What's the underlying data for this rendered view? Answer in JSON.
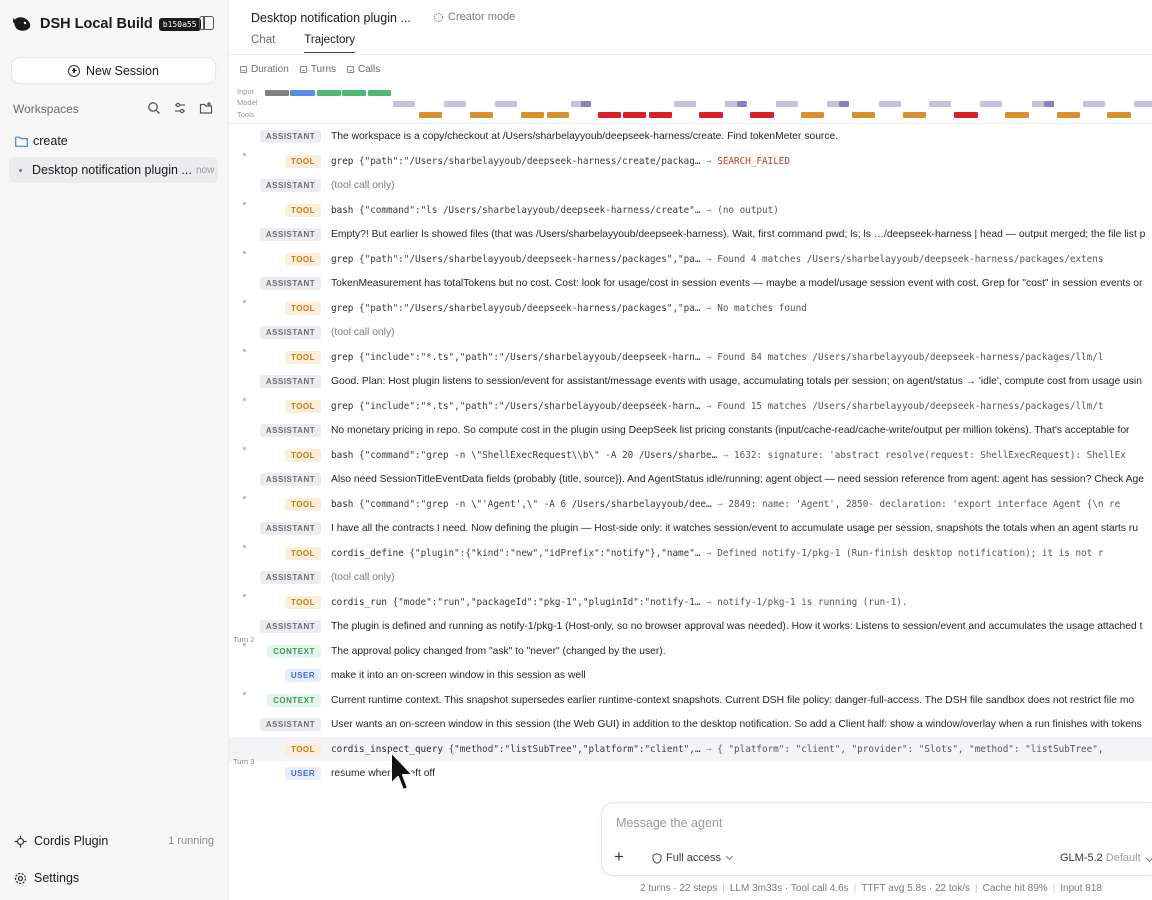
{
  "app": {
    "title": "DSH Local Build",
    "build_badge": "b150a55"
  },
  "sidebar": {
    "new_session": "New Session",
    "workspaces_label": "Workspaces",
    "folder": "create",
    "session": {
      "name": "Desktop notification plugin ...",
      "time": "now"
    },
    "plugin": {
      "label": "Cordis Plugin",
      "status": "1 running"
    },
    "settings": "Settings"
  },
  "header": {
    "title": "Desktop notification plugin ...",
    "mode": "Creator mode",
    "tabs": [
      "Chat",
      "Trajectory"
    ]
  },
  "metrics": [
    "Duration",
    "Turns",
    "Calls"
  ],
  "timeline": {
    "lanes": [
      "Input",
      "Model",
      "Tools"
    ],
    "colors": {
      "input_gray": "#808080",
      "input_blue": "#5b8de8",
      "input_green": "#4fb872",
      "model": "#c8c2dc",
      "model_dark": "#8e80c0",
      "tool_orange": "#d9912f",
      "tool_red": "#dc1d2a"
    }
  },
  "rows": [
    {
      "type": "assistant",
      "badge": "ASSISTANT",
      "text": "The workspace is a copy/checkout at /Users/sharbelayyoub/deepseek-harness/create. Find tokenMeter source."
    },
    {
      "type": "tool",
      "badge": "TOOL",
      "name": "grep",
      "args": "{\"path\":\"/Users/sharbelayyoub/deepseek-harness/create/packag…",
      "result": "SEARCH_FAILED",
      "error": true
    },
    {
      "type": "assistant",
      "badge": "ASSISTANT",
      "text": "(tool call only)",
      "muted": true
    },
    {
      "type": "tool",
      "badge": "TOOL",
      "name": "bash",
      "args": "{\"command\":\"ls /Users/sharbelayyoub/deepseek-harness/create\"…",
      "result": "(no output)"
    },
    {
      "type": "assistant",
      "badge": "ASSISTANT",
      "text": "Empty?! But earlier ls showed files (that was /Users/sharbelayyoub/deepseek-harness). Wait, first command pwd; ls; ls …/deepseek-harness | head — output merged; the file list p"
    },
    {
      "type": "tool",
      "badge": "TOOL",
      "name": "grep",
      "args": "{\"path\":\"/Users/sharbelayyoub/deepseek-harness/packages\",\"pa…",
      "result": "Found 4 matches /Users/sharbelayyoub/deepseek-harness/packages/extens"
    },
    {
      "type": "assistant",
      "badge": "ASSISTANT",
      "text": "TokenMeasurement has totalTokens but no cost. Cost: look for usage/cost in session events — maybe a model/usage session event with cost. Grep for \"cost\" in session events or"
    },
    {
      "type": "tool",
      "badge": "TOOL",
      "name": "grep",
      "args": "{\"path\":\"/Users/sharbelayyoub/deepseek-harness/packages\",\"pa…",
      "result": "No matches found"
    },
    {
      "type": "assistant",
      "badge": "ASSISTANT",
      "text": "(tool call only)",
      "muted": true
    },
    {
      "type": "tool",
      "badge": "TOOL",
      "name": "grep",
      "args": "{\"include\":\"*.ts\",\"path\":\"/Users/sharbelayyoub/deepseek-harn…",
      "result": "Found 84 matches /Users/sharbelayyoub/deepseek-harness/packages/llm/l"
    },
    {
      "type": "assistant",
      "badge": "ASSISTANT",
      "text": "Good. Plan: Host plugin listens to session/event for assistant/message events with usage, accumulating totals per session; on agent/status → 'idle', compute cost from usage usin"
    },
    {
      "type": "tool",
      "badge": "TOOL",
      "name": "grep",
      "args": "{\"include\":\"*.ts\",\"path\":\"/Users/sharbelayyoub/deepseek-harn…",
      "result": "Found 15 matches /Users/sharbelayyoub/deepseek-harness/packages/llm/t"
    },
    {
      "type": "assistant",
      "badge": "ASSISTANT",
      "text": "No monetary pricing in repo. So compute cost in the plugin using DeepSeek list pricing constants (input/cache-read/cache-write/output per million tokens). That's acceptable for"
    },
    {
      "type": "tool",
      "badge": "TOOL",
      "name": "bash",
      "args": "{\"command\":\"grep -n \\\"ShellExecRequest\\\\b\\\" -A 20 /Users/sharbe…",
      "result": "1632: signature: 'abstract resolve(request: ShellExecRequest): ShellEx"
    },
    {
      "type": "assistant",
      "badge": "ASSISTANT",
      "text": "Also need SessionTitleEventData fields (probably {title, source}). And AgentStatus idle/running; agent object — need session reference from agent: agent has session? Check Age"
    },
    {
      "type": "tool",
      "badge": "TOOL",
      "name": "bash",
      "args": "{\"command\":\"grep -n \\\"'Agent',\\\" -A 6 /Users/sharbelayyoub/dee…",
      "result": "2849: name: 'Agent', 2850- declaration: 'export interface Agent {\\n re"
    },
    {
      "type": "assistant",
      "badge": "ASSISTANT",
      "text": "I have all the contracts I need. Now defining the plugin — Host-side only: it watches session/event to accumulate usage per session, snapshots the totals when an agent starts ru"
    },
    {
      "type": "tool",
      "badge": "TOOL",
      "name": "cordis_define",
      "args": "{\"plugin\":{\"kind\":\"new\",\"idPrefix\":\"notify\"},\"name\"…",
      "result": "Defined notify-1/pkg-1 (Run-finish desktop notification); it is not r"
    },
    {
      "type": "assistant",
      "badge": "ASSISTANT",
      "text": "(tool call only)",
      "muted": true
    },
    {
      "type": "tool",
      "badge": "TOOL",
      "name": "cordis_run",
      "args": "{\"mode\":\"run\",\"packageId\":\"pkg-1\",\"pluginId\":\"notify-1…",
      "result": "notify-1/pkg-1 is running (run-1)."
    },
    {
      "type": "assistant",
      "badge": "ASSISTANT",
      "text": "The plugin is defined and running as notify-1/pkg-1 (Host-only, so no browser approval was needed). How it works: Listens to session/event and accumulates the usage attached t"
    },
    {
      "type": "context",
      "badge": "CONTEXT",
      "text": "The approval policy changed from \"ask\" to \"never\" (changed by the user).",
      "turn": "Turn 2"
    },
    {
      "type": "user",
      "badge": "USER",
      "text": "make it into an on-screen window in this session as well"
    },
    {
      "type": "context",
      "badge": "CONTEXT",
      "text": "Current runtime context. This snapshot supersedes earlier runtime-context snapshots. Current DSH file policy: danger-full-access. The DSH file sandbox does not restrict file mo"
    },
    {
      "type": "assistant",
      "badge": "ASSISTANT",
      "text": "User wants an on-screen window in this session (the Web GUI) in addition to the desktop notification. So add a Client half: show a window/overlay when a run finishes with tokens"
    },
    {
      "type": "tool",
      "badge": "TOOL",
      "name": "cordis_inspect_query",
      "args": "{\"method\":\"listSubTree\",\"platform\":\"client\",…",
      "result": "{ \"platform\": \"client\", \"provider\": \"Slots\", \"method\": \"listSubTree\",",
      "highlight": true
    },
    {
      "type": "user",
      "badge": "USER",
      "text": "resume where it left off",
      "turn": "Turn 3"
    }
  ],
  "composer": {
    "placeholder": "Message the agent",
    "access": "Full access",
    "model": "GLM-5.2",
    "model_default": "Default"
  },
  "status_bar": [
    "2 turns · 22 steps",
    "LLM 3m33s · Tool call 4.6s",
    "TTFT avg 5.8s · 22 tok/s",
    "Cache hit 89%",
    "Input 818"
  ]
}
